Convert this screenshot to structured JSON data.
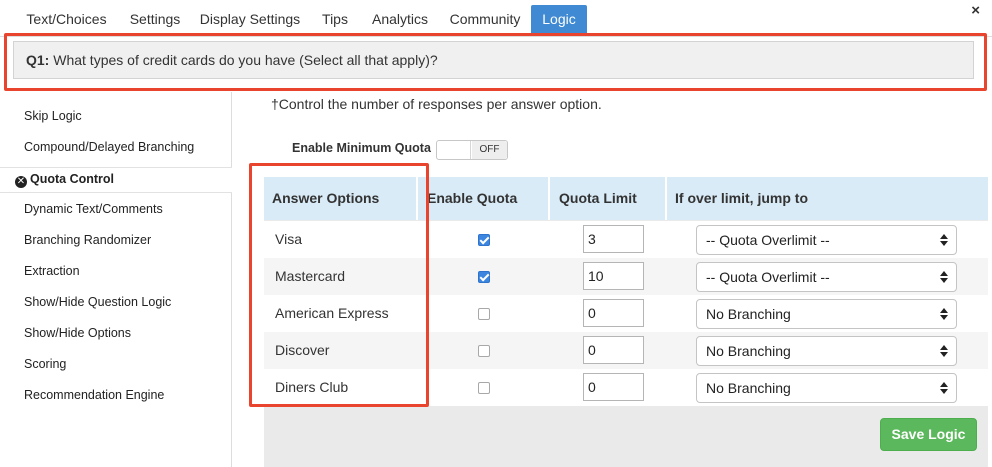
{
  "tabs": [
    {
      "label": "Text/Choices",
      "active": false
    },
    {
      "label": "Settings",
      "active": false
    },
    {
      "label": "Display Settings",
      "active": false
    },
    {
      "label": "Tips",
      "active": false
    },
    {
      "label": "Analytics",
      "active": false
    },
    {
      "label": "Community",
      "active": false
    },
    {
      "label": "Logic",
      "active": true
    }
  ],
  "close_label": "×",
  "question": {
    "number": "Q1:",
    "text": "What types of credit cards do you have (Select all that apply)?"
  },
  "sidebar": {
    "items": [
      {
        "label": "Skip Logic"
      },
      {
        "label": "Compound/Delayed Branching"
      },
      {
        "label": "Quota Control",
        "active": true
      },
      {
        "label": "Dynamic Text/Comments"
      },
      {
        "label": "Branching Randomizer"
      },
      {
        "label": "Extraction"
      },
      {
        "label": "Show/Hide Question Logic"
      },
      {
        "label": "Show/Hide Options"
      },
      {
        "label": "Scoring"
      },
      {
        "label": "Recommendation Engine"
      }
    ]
  },
  "main": {
    "note": "†Control the number of responses per answer option.",
    "min_quota_label": "Enable Minimum Quota",
    "min_quota_state": "OFF",
    "columns": [
      "Answer Options",
      "Enable Quota",
      "Quota Limit",
      "If over limit, jump to"
    ],
    "rows": [
      {
        "option": "Visa",
        "enabled": true,
        "limit": "3",
        "jump": "-- Quota Overlimit --"
      },
      {
        "option": "Mastercard",
        "enabled": true,
        "limit": "10",
        "jump": "-- Quota Overlimit --"
      },
      {
        "option": "American Express",
        "enabled": false,
        "limit": "0",
        "jump": "No Branching"
      },
      {
        "option": "Discover",
        "enabled": false,
        "limit": "0",
        "jump": "No Branching"
      },
      {
        "option": "Diners Club",
        "enabled": false,
        "limit": "0",
        "jump": "No Branching"
      }
    ],
    "save_label": "Save Logic"
  },
  "colors": {
    "active_tab": "#3f8ad2",
    "table_header": "#d9ebf7",
    "checkbox_checked": "#3d86e0",
    "save_button": "#5cb85c",
    "highlight": "#e8442e"
  }
}
